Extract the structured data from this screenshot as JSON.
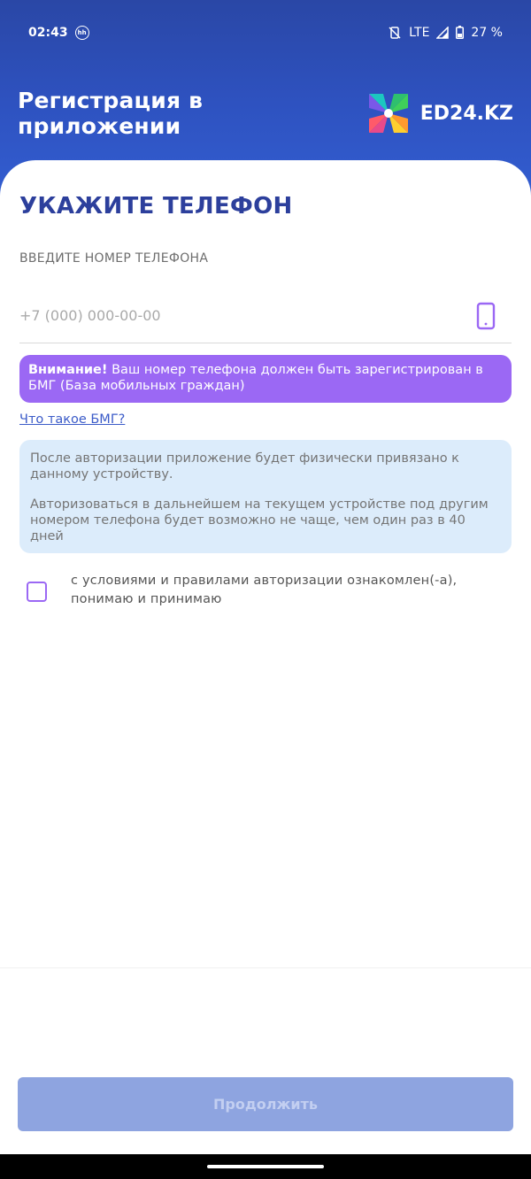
{
  "status_bar": {
    "time": "02:43",
    "hh_badge": "hh",
    "network": "LTE",
    "battery": "27 %"
  },
  "header": {
    "title": "Регистрация в приложении",
    "logo_text": "ED24.KZ"
  },
  "form": {
    "title": "УКАЖИТЕ ТЕЛЕФОН",
    "phone_label": "ВВЕДИТЕ НОМЕР ТЕЛЕФОНА",
    "phone_placeholder": "+7 (000) 000-00-00",
    "phone_value": "",
    "warning_bold": "Внимание!",
    "warning_text": " Ваш номер телефона должен быть зарегистрирован в БМГ (База мобильных граждан)",
    "bmg_link": "Что такое БМГ?",
    "info_p1": "После авторизации приложение будет физически привязано к данному устройству.",
    "info_p2": "Авторизоваться в дальнейшем на текущем устройстве под другим номером телефона будет возможно не чаще, чем один раз в 40 дней",
    "agree_text": "с условиями и правилами авторизации ознакомлен(-а), понимаю и принимаю",
    "agree_checked": false,
    "continue_label": "Продолжить"
  },
  "colors": {
    "header_blue": "#2e52c0",
    "title_blue": "#2c3f9c",
    "warning_purple": "#9b68f4",
    "info_bg": "#dcecfb",
    "button_disabled": "#8ea4e0"
  },
  "icons": {
    "phone": "smartphone-icon",
    "mute": "vibrate-off-icon",
    "signal": "signal-icon",
    "battery": "battery-charging-icon",
    "logo": "pinwheel-logo-icon"
  }
}
